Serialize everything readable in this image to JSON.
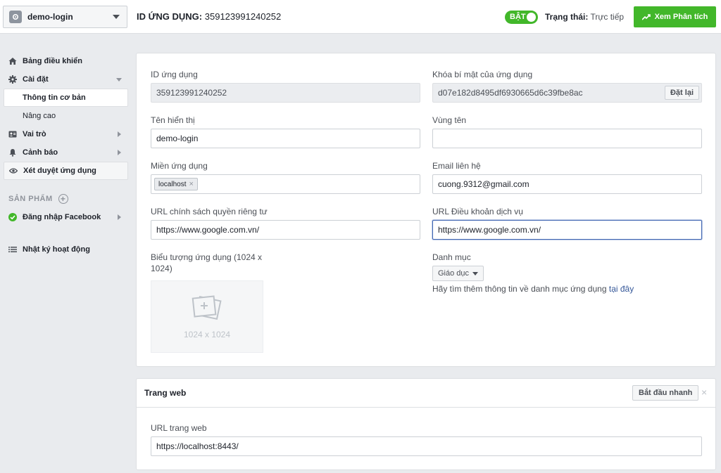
{
  "header": {
    "app_name": "demo-login",
    "app_id_label": "ID ỨNG DỤNG:",
    "app_id_value": "359123991240252",
    "toggle_label": "BẬT",
    "status_label": "Trạng thái:",
    "status_value": "Trực tiếp",
    "analytics_button": "Xem Phân tích"
  },
  "sidebar": {
    "dashboard": "Bảng điều khiển",
    "settings": "Cài đặt",
    "basic_info": "Thông tin cơ bản",
    "advanced": "Nâng cao",
    "roles": "Vai trò",
    "alerts": "Cảnh báo",
    "app_review": "Xét duyệt ứng dụng",
    "products_label": "SẢN PHẨM",
    "facebook_login": "Đăng nhập Facebook",
    "activity_log": "Nhật ký hoạt động"
  },
  "basic": {
    "app_id_label": "ID ứng dụng",
    "app_id_value": "359123991240252",
    "secret_label": "Khóa bí mật của ứng dụng",
    "secret_value": "d07e182d8495df6930665d6c39fbe8ac",
    "reset_button": "Đặt lại",
    "display_name_label": "Tên hiển thị",
    "display_name_value": "demo-login",
    "namespace_label": "Vùng tên",
    "namespace_value": "",
    "domains_label": "Miền ứng dụng",
    "domains": [
      "localhost"
    ],
    "email_label": "Email liên hệ",
    "email_value": "cuong.9312@gmail.com",
    "privacy_label": "URL chính sách quyền riêng tư",
    "privacy_value": "https://www.google.com.vn/",
    "tos_label": "URL Điều khoản dịch vụ",
    "tos_value": "https://www.google.com.vn/",
    "icon_label": "Biểu tượng ứng dụng (1024 x 1024)",
    "icon_placeholder": "1024 x 1024",
    "category_label": "Danh mục",
    "category_value": "Giáo dục",
    "category_hint": "Hãy tìm thêm thông tin về danh mục ứng dụng",
    "category_hint_link": "tại đây"
  },
  "website": {
    "title": "Trang web",
    "quickstart_button": "Bắt đầu nhanh",
    "close": "×",
    "url_label": "URL trang web",
    "url_value": "https://localhost:8443/"
  },
  "colors": {
    "accent_green": "#42b72a",
    "link_blue": "#365899",
    "focus_blue": "#4267b2"
  }
}
